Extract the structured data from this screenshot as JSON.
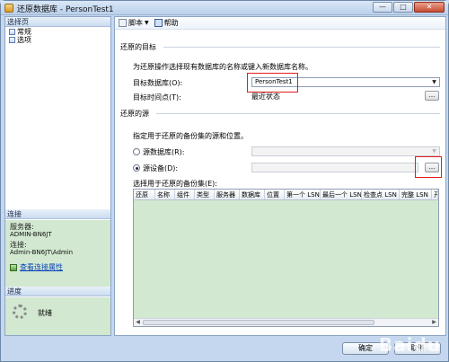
{
  "window": {
    "title": "还原数据库 - PersonTest1",
    "minimize_glyph": "—",
    "maximize_glyph": "□",
    "close_glyph": "✕"
  },
  "sidebar": {
    "select_page_header": "选择页",
    "pages": [
      {
        "label": "常规",
        "icon": "page-icon"
      },
      {
        "label": "选项",
        "icon": "page-icon"
      }
    ],
    "connection": {
      "header": "连接",
      "server_label": "服务器:",
      "server_value": "ADMIN-BN6JT",
      "connection_label": "连接:",
      "connection_value": "Admin-BN6JT\\Admin",
      "link_label": "查看连接属性"
    },
    "progress": {
      "header": "进度",
      "status": "就绪"
    }
  },
  "toolbar": {
    "script_label": "脚本",
    "script_dropdown": "▼",
    "help_label": "帮助"
  },
  "restore_target": {
    "group_title": "还原的目标",
    "description": "为还原操作选择现有数据库的名称或键入新数据库名称。",
    "target_db_label": "目标数据库(O):",
    "target_db_value": "PersonTest1",
    "target_time_label": "目标时间点(T):",
    "target_time_value": "最近状态",
    "browse_button": "..."
  },
  "restore_source": {
    "group_title": "还原的源",
    "description": "指定用于还原的备份集的源和位置。",
    "source_db_label": "源数据库(R):",
    "source_db_value": "",
    "source_device_label": "源设备(D):",
    "source_device_value": "",
    "browse_button": "..."
  },
  "backup_sets": {
    "label": "选择用于还原的备份集(E):",
    "columns": [
      "还原",
      "名称",
      "组件",
      "类型",
      "服务器",
      "数据库",
      "位置",
      "第一个 LSN",
      "最后一个 LSN",
      "检查点 LSN",
      "完整 LSN",
      "开"
    ],
    "rows": []
  },
  "footer": {
    "ok_label": "确定",
    "cancel_label": "取消"
  },
  "watermark": "Baidu"
}
